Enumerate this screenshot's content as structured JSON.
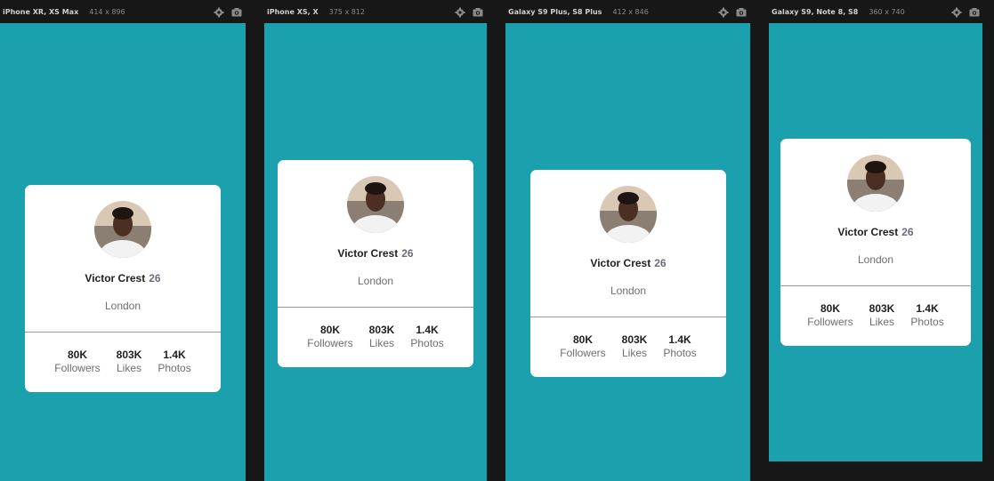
{
  "devices": [
    {
      "name": "iPhone XR, XS Max",
      "size": "414 x 896"
    },
    {
      "name": "iPhone XS, X",
      "size": "375 x 812"
    },
    {
      "name": "Galaxy S9 Plus, S8 Plus",
      "size": "412 x 846"
    },
    {
      "name": "Galaxy S9, Note 8, S8",
      "size": "360 x 740"
    }
  ],
  "profile": {
    "name": "Victor Crest",
    "age": "26",
    "city": "London",
    "stats": [
      {
        "value": "80K",
        "label": "Followers"
      },
      {
        "value": "803K",
        "label": "Likes"
      },
      {
        "value": "1.4K",
        "label": "Photos"
      }
    ]
  },
  "colors": {
    "background": "#1aa1ad",
    "card": "#ffffff",
    "toolbar": "#171717"
  },
  "icons": [
    "gear-icon",
    "camera-icon"
  ]
}
